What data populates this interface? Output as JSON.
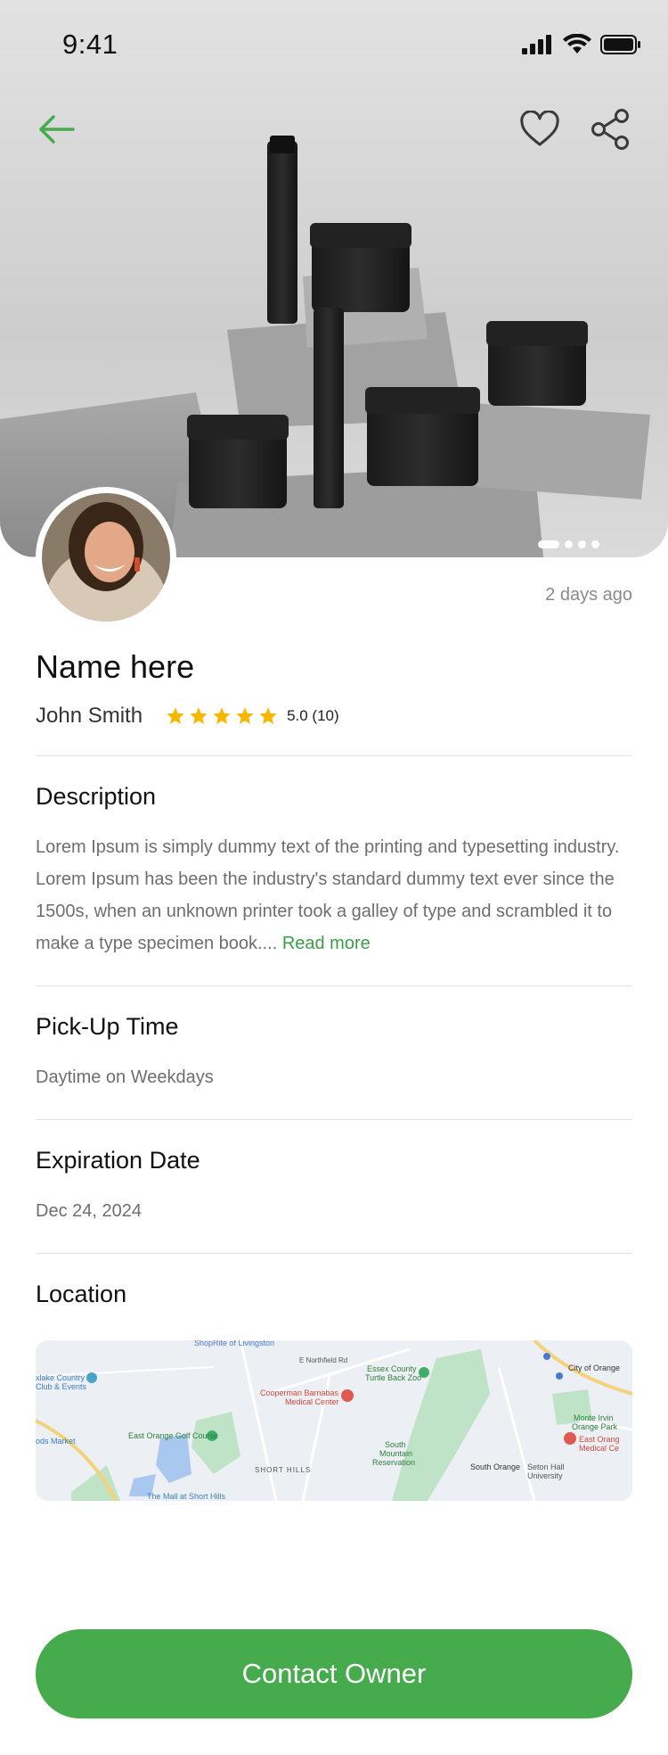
{
  "status_bar": {
    "time": "9:41"
  },
  "hero": {
    "image_description_icon": "product-photo",
    "carousel": {
      "count": 4,
      "active_index": 0
    }
  },
  "actions": {
    "back_icon": "arrow-left-icon",
    "favorite_icon": "heart-icon",
    "share_icon": "share-icon"
  },
  "listing": {
    "posted": "2 days ago",
    "title": "Name here",
    "owner": "John Smith",
    "rating": {
      "stars": 5,
      "max": 5,
      "label": "5.0 (10)"
    }
  },
  "description": {
    "title": "Description",
    "text": "Lorem Ipsum is simply dummy text of the printing and typesetting industry. Lorem Ipsum has been the industry's standard dummy text ever since the 1500s, when an unknown printer took a galley of type and scrambled it to make a type specimen book....",
    "read_more": "Read more"
  },
  "pickup": {
    "title": "Pick-Up Time",
    "value": "Daytime on Weekdays"
  },
  "expiration": {
    "title": "Expiration Date",
    "value": "Dec 24, 2024"
  },
  "location": {
    "title": "Location",
    "map_labels": {
      "shoprite": "ShopRite of Livingston",
      "essex": "Essex County",
      "essex2": "Turtle Back Zoo",
      "cooperman": "Cooperman Barnabas",
      "cooperman2": "Medical Center",
      "golf": "East Orange Golf Course",
      "short_hills": "SHORT HILLS",
      "south_mountain": "South",
      "south_mountain2": "Mountain",
      "south_mountain3": "Reservation",
      "south_orange": "South Orange",
      "seton": "Seton Hall",
      "seton2": "University",
      "city_orange": "City of Orange",
      "monte_irvin": "Monte Irvin",
      "monte_irvin2": "Orange Park",
      "east_orange_med": "East Orang",
      "east_orange_med2": "Medical Ce",
      "country_club": "xlake Country",
      "country_club2": "Club & Events",
      "market": "ods Market",
      "mall": "The Mall at Short Hills",
      "northfield": "E Northfield Rd"
    }
  },
  "cta": {
    "label": "Contact Owner"
  },
  "colors": {
    "accent": "#46ab4d",
    "link": "#3a9e45",
    "star": "#f5b800",
    "muted_text": "#6e6e6e"
  }
}
